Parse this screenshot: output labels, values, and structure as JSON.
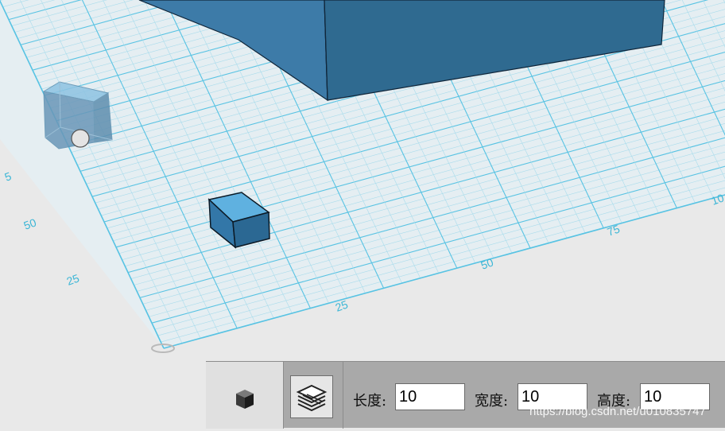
{
  "viewport": {
    "ticks": {
      "left_axis": [
        "5",
        "50",
        "25"
      ],
      "bottom_axis": [
        "25",
        "50",
        "75",
        "10"
      ]
    },
    "colors": {
      "grid_minor": "#a9dcec",
      "grid_major": "#58c3e3",
      "plane": "#e5eef2",
      "solid_top": "#3d7ba8",
      "solid_side": "#2f6a90",
      "ghost_box": "#6f9fc0",
      "small_cube_top": "#5fb1e0",
      "small_cube_front": "#3377a8"
    }
  },
  "toolbar": {
    "cube_icon": "cube-icon",
    "layers_icon": "layers-icon",
    "length_label": "长度:",
    "length_value": "10",
    "width_label": "宽度:",
    "width_value": "10",
    "height_label": "高度:",
    "height_value": "10"
  },
  "watermark": "https://blog.csdn.net/u010835747"
}
